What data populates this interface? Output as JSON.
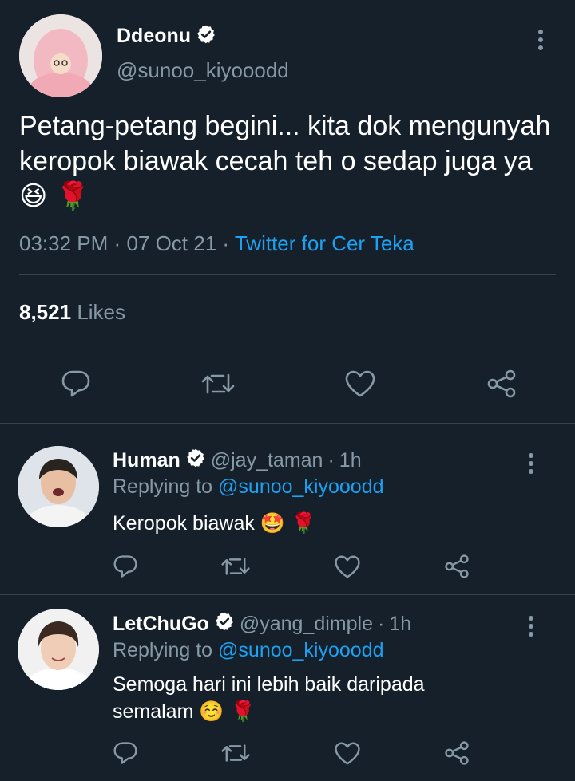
{
  "tweet": {
    "name": "Ddeonu",
    "handle": "@sunoo_kiyooodd",
    "text": "Petang-petang begini... kita dok mengunyah keropok biawak cecah teh o sedap juga ya",
    "emojis": "😆 🌹",
    "time": "03:32 PM",
    "date": "07 Oct 21",
    "source": "Twitter for Cer Teka",
    "likes_count": "8,521",
    "likes_label": "Likes"
  },
  "replies": [
    {
      "name": "Human",
      "handle": "@jay_taman",
      "age": "1h",
      "replying_prefix": "Replying to",
      "replying_to": "@sunoo_kiyooodd",
      "text": "Keropok biawak",
      "emojis": "🤩 🌹"
    },
    {
      "name": "LetChuGo",
      "handle": "@yang_dimple",
      "age": "1h",
      "replying_prefix": "Replying to",
      "replying_to": "@sunoo_kiyooodd",
      "text": "Semoga hari ini lebih baik daripada semalam",
      "emojis": "☺️ 🌹"
    }
  ],
  "icons": {
    "verified": "verified-badge-icon",
    "more": "more-vertical-icon",
    "reply": "reply-icon",
    "retweet": "retweet-icon",
    "like": "heart-icon",
    "share": "share-icon"
  },
  "colors": {
    "background": "#15202b",
    "accent": "#1da1f2",
    "muted": "#8899a6",
    "divider": "#38444d"
  }
}
